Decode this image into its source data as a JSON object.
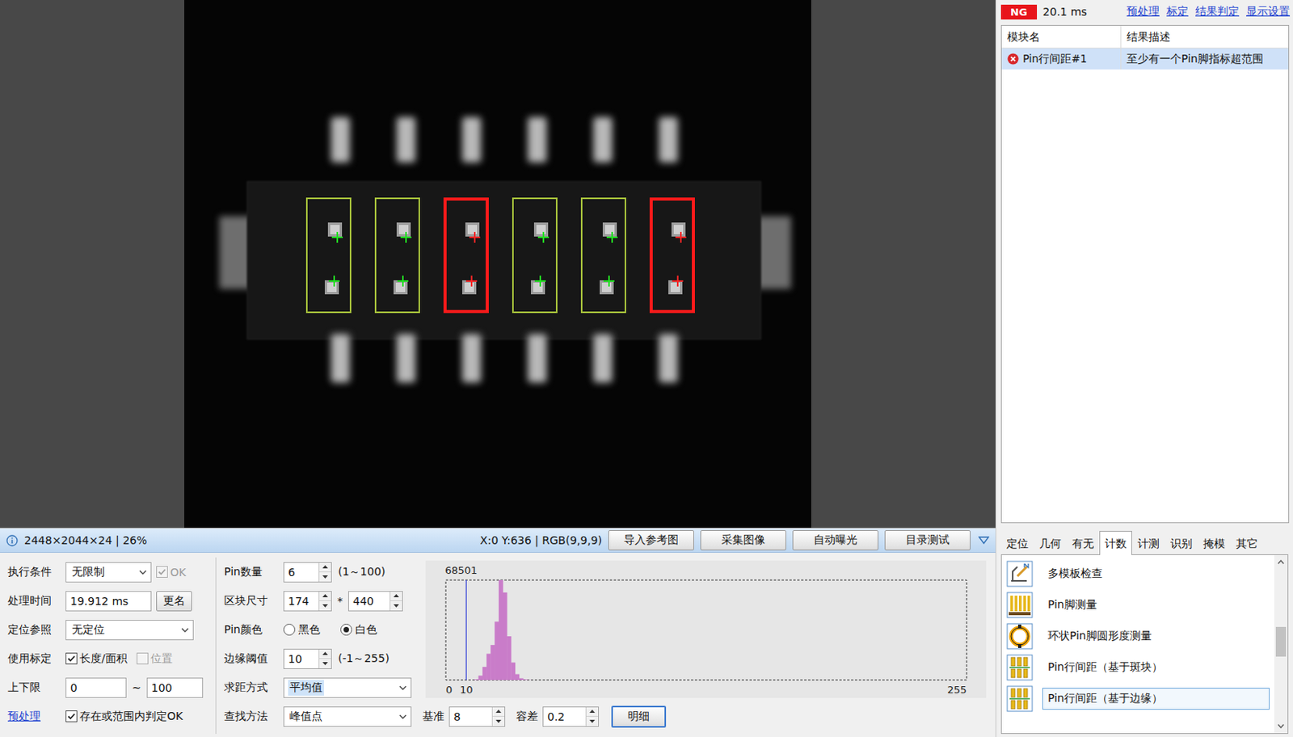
{
  "image_view": {
    "pin_blocks": [
      {
        "ok": true
      },
      {
        "ok": true
      },
      {
        "ok": false
      },
      {
        "ok": true
      },
      {
        "ok": true
      },
      {
        "ok": false
      }
    ]
  },
  "result_panel": {
    "status": "NG",
    "time": "20.1 ms",
    "links": [
      "预处理",
      "标定",
      "结果判定",
      "显示设置"
    ],
    "columns": [
      "模块名",
      "结果描述"
    ],
    "rows": [
      {
        "module": "Pin行间距#1",
        "description": "至少有一个Pin脚指标超范围",
        "ok": false,
        "selected": true
      }
    ]
  },
  "status_bar": {
    "image_info": "2448×2044×24 | 26%",
    "cursor": "X:0 Y:636 | RGB(9,9,9)",
    "buttons": [
      "导入参考图",
      "采集图像",
      "自动曝光",
      "目录测试"
    ]
  },
  "tool_tabs": [
    {
      "label": "定位",
      "selected": false
    },
    {
      "label": "几何",
      "selected": false
    },
    {
      "label": "有无",
      "selected": false
    },
    {
      "label": "计数",
      "selected": true
    },
    {
      "label": "计测",
      "selected": false
    },
    {
      "label": "识别",
      "selected": false
    },
    {
      "label": "掩模",
      "selected": false
    },
    {
      "label": "其它",
      "selected": false
    }
  ],
  "tool_list": [
    {
      "label": "多模板检查",
      "kind": "template",
      "selected": false
    },
    {
      "label": "Pin脚测量",
      "kind": "pins",
      "selected": false
    },
    {
      "label": "环状Pin脚圆形度测量",
      "kind": "ring",
      "selected": false
    },
    {
      "label": "Pin行间距（基于斑块）",
      "kind": "spacing",
      "selected": false
    },
    {
      "label": "Pin行间距（基于边缘）",
      "kind": "spacing",
      "selected": true
    }
  ],
  "params": {
    "execute_condition": {
      "label": "执行条件",
      "value": "无限制",
      "ok_label": "OK",
      "ok_checked": true,
      "ok_disabled": true
    },
    "processing_time": {
      "label": "处理时间",
      "value": "19.912 ms",
      "button": "更名"
    },
    "locate_ref": {
      "label": "定位参照",
      "value": "无定位"
    },
    "calibration": {
      "label": "使用标定",
      "options": [
        {
          "label": "长度/面积",
          "checked": true,
          "disabled": false
        },
        {
          "label": "位置",
          "checked": false,
          "disabled": true
        }
      ]
    },
    "limits": {
      "label": "上下限",
      "min": "0",
      "sep": "~",
      "max": "100"
    },
    "preprocess": {
      "link": "预处理",
      "check_label": "存在或范围内判定OK",
      "checked": true
    },
    "pin_count": {
      "label": "Pin数量",
      "value": "6",
      "range": "(1～100)"
    },
    "block_size": {
      "label": "区块尺寸",
      "width": "174",
      "sep": "*",
      "height": "440"
    },
    "pin_color": {
      "label": "Pin颜色",
      "options": [
        {
          "label": "黑色",
          "selected": false
        },
        {
          "label": "白色",
          "selected": true
        }
      ]
    },
    "edge_threshold": {
      "label": "边缘阈值",
      "value": "10",
      "range": "(-1～255)"
    },
    "distance_method": {
      "label": "求距方式",
      "value": "平均值",
      "focused": true
    },
    "find_method": {
      "label": "查找方法",
      "value": "峰值点"
    },
    "reference": {
      "label": "基准",
      "value": "8"
    },
    "tolerance": {
      "label": "容差",
      "value": "0.2"
    },
    "detail_button": "明细",
    "histogram": {
      "max_label": "68501",
      "ticks": [
        "0",
        "10",
        "255"
      ],
      "threshold": 10,
      "values": [
        0,
        0,
        0,
        0,
        0,
        0,
        0,
        500,
        3000,
        9000,
        18000,
        24000,
        40000,
        68501,
        60000,
        30000,
        12000,
        4000,
        1200,
        400,
        100,
        0,
        0,
        0,
        0,
        0,
        0,
        0,
        0,
        0,
        0,
        0,
        0,
        0,
        0,
        0,
        0,
        0,
        0,
        0,
        0,
        0,
        0,
        0,
        0,
        0,
        0,
        0,
        0,
        0,
        0,
        0,
        0,
        0,
        0,
        0,
        0,
        0,
        0,
        0,
        0,
        0,
        0,
        0,
        0,
        0,
        0,
        0,
        0,
        0,
        0,
        0,
        0,
        0,
        0,
        0,
        0,
        0,
        0,
        0,
        0,
        0,
        0,
        0,
        0,
        0,
        0,
        0,
        0,
        0,
        0,
        0,
        0,
        0,
        0,
        0,
        0,
        0,
        0,
        0,
        0,
        0,
        0,
        0,
        0,
        0,
        0,
        0,
        0,
        0,
        0,
        0,
        0,
        0,
        0,
        0,
        0,
        0,
        0,
        0,
        0,
        0,
        0,
        0,
        0,
        0,
        0,
        0
      ]
    }
  }
}
